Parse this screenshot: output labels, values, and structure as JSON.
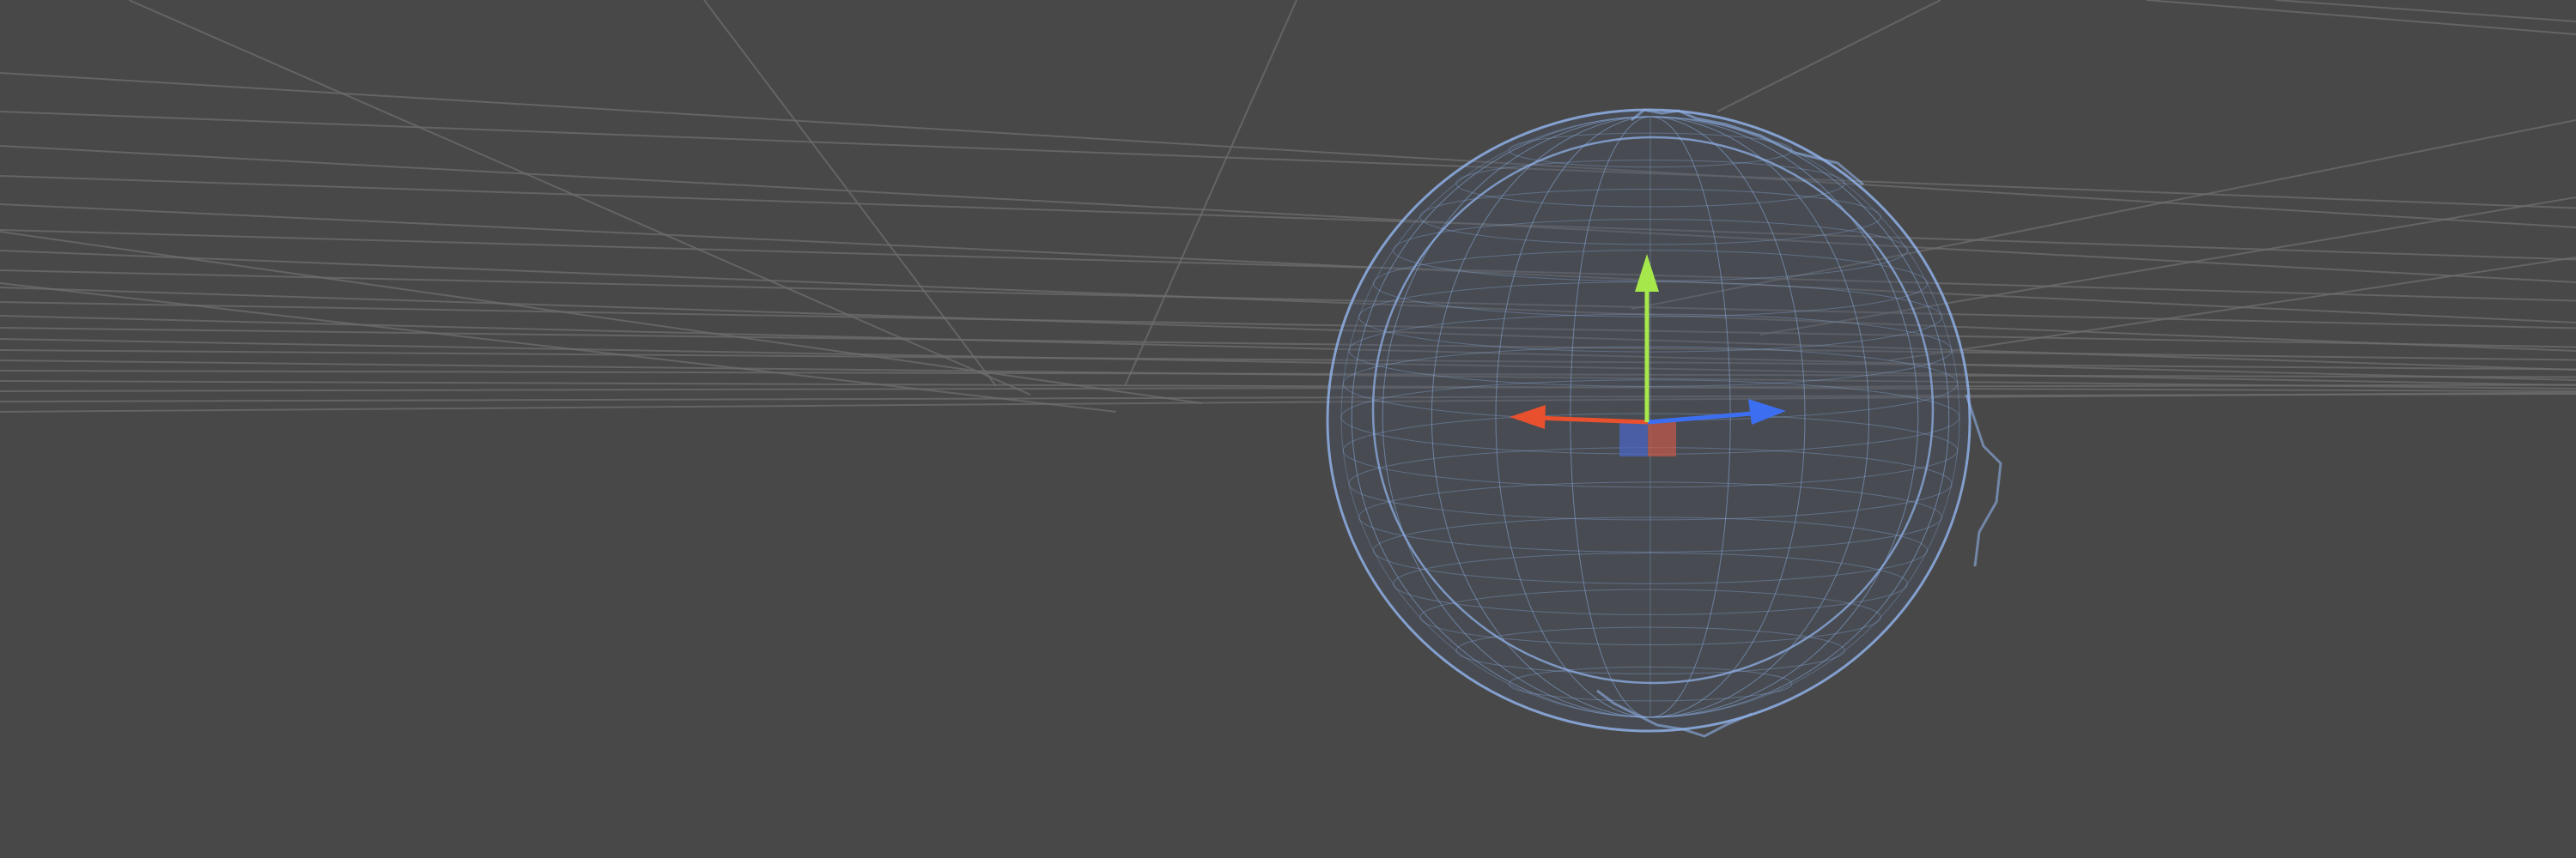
{
  "viewport": {
    "background_color": "#484848",
    "grid_color": "#6e6e6e",
    "grid_visible": true,
    "selected_object": {
      "icon": "wireframe-sphere-mesh-icon",
      "wire_color": "#8fb0e8",
      "fill_color": "#4a5666"
    },
    "transform_gizmo": {
      "mode": "move",
      "icon": "move-gizmo-icon",
      "axis_colors": {
        "x": "#e8502e",
        "y": "#a6e84b",
        "z": "#3b6ef0"
      },
      "plane_handle_colors": {
        "xy_plane": "#4a66c8",
        "yz_plane": "#c8584a"
      }
    }
  }
}
